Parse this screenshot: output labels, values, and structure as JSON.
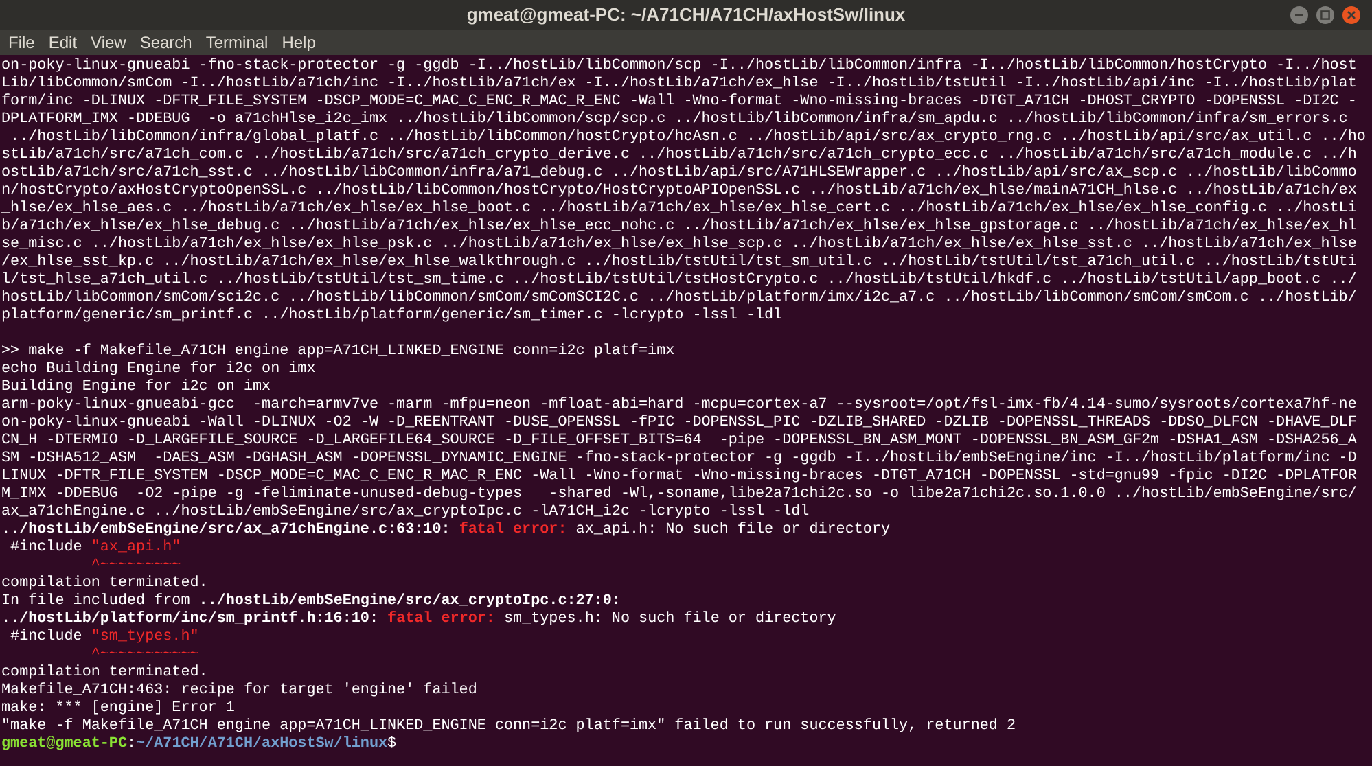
{
  "window": {
    "title": "gmeat@gmeat-PC: ~/A71CH/A71CH/axHostSw/linux"
  },
  "menu": [
    "File",
    "Edit",
    "View",
    "Search",
    "Terminal",
    "Help"
  ],
  "lines": [
    {
      "kind": "text",
      "segments": [
        {
          "kind": "plain",
          "text": "on-poky-linux-gnueabi -fno-stack-protector -g -ggdb -I../hostLib/libCommon/scp -I../hostLib/libCommon/infra -I../hostLib/libCommon/hostCrypto -I../host"
        }
      ]
    },
    {
      "kind": "text",
      "segments": [
        {
          "kind": "plain",
          "text": "Lib/libCommon/smCom -I../hostLib/a71ch/inc -I../hostLib/a71ch/ex -I../hostLib/a71ch/ex_hlse -I../hostLib/tstUtil -I../hostLib/api/inc -I../hostLib/plat"
        }
      ]
    },
    {
      "kind": "text",
      "segments": [
        {
          "kind": "plain",
          "text": "form/inc -DLINUX -DFTR_FILE_SYSTEM -DSCP_MODE=C_MAC_C_ENC_R_MAC_R_ENC -Wall -Wno-format -Wno-missing-braces -DTGT_A71CH -DHOST_CRYPTO -DOPENSSL -DI2C -"
        }
      ]
    },
    {
      "kind": "text",
      "segments": [
        {
          "kind": "plain",
          "text": "DPLATFORM_IMX -DDEBUG  -o a71chHlse_i2c_imx ../hostLib/libCommon/scp/scp.c ../hostLib/libCommon/infra/sm_apdu.c ../hostLib/libCommon/infra/sm_errors.c"
        }
      ]
    },
    {
      "kind": "text",
      "segments": [
        {
          "kind": "plain",
          "text": " ../hostLib/libCommon/infra/global_platf.c ../hostLib/libCommon/hostCrypto/hcAsn.c ../hostLib/api/src/ax_crypto_rng.c ../hostLib/api/src/ax_util.c ../ho"
        }
      ]
    },
    {
      "kind": "text",
      "segments": [
        {
          "kind": "plain",
          "text": "stLib/a71ch/src/a71ch_com.c ../hostLib/a71ch/src/a71ch_crypto_derive.c ../hostLib/a71ch/src/a71ch_crypto_ecc.c ../hostLib/a71ch/src/a71ch_module.c ../h"
        }
      ]
    },
    {
      "kind": "text",
      "segments": [
        {
          "kind": "plain",
          "text": "ostLib/a71ch/src/a71ch_sst.c ../hostLib/libCommon/infra/a71_debug.c ../hostLib/api/src/A71HLSEWrapper.c ../hostLib/api/src/ax_scp.c ../hostLib/libCommo"
        }
      ]
    },
    {
      "kind": "text",
      "segments": [
        {
          "kind": "plain",
          "text": "n/hostCrypto/axHostCryptoOpenSSL.c ../hostLib/libCommon/hostCrypto/HostCryptoAPIOpenSSL.c ../hostLib/a71ch/ex_hlse/mainA71CH_hlse.c ../hostLib/a71ch/ex"
        }
      ]
    },
    {
      "kind": "text",
      "segments": [
        {
          "kind": "plain",
          "text": "_hlse/ex_hlse_aes.c ../hostLib/a71ch/ex_hlse/ex_hlse_boot.c ../hostLib/a71ch/ex_hlse/ex_hlse_cert.c ../hostLib/a71ch/ex_hlse/ex_hlse_config.c ../hostLi"
        }
      ]
    },
    {
      "kind": "text",
      "segments": [
        {
          "kind": "plain",
          "text": "b/a71ch/ex_hlse/ex_hlse_debug.c ../hostLib/a71ch/ex_hlse/ex_hlse_ecc_nohc.c ../hostLib/a71ch/ex_hlse/ex_hlse_gpstorage.c ../hostLib/a71ch/ex_hlse/ex_hl"
        }
      ]
    },
    {
      "kind": "text",
      "segments": [
        {
          "kind": "plain",
          "text": "se_misc.c ../hostLib/a71ch/ex_hlse/ex_hlse_psk.c ../hostLib/a71ch/ex_hlse/ex_hlse_scp.c ../hostLib/a71ch/ex_hlse/ex_hlse_sst.c ../hostLib/a71ch/ex_hlse"
        }
      ]
    },
    {
      "kind": "text",
      "segments": [
        {
          "kind": "plain",
          "text": "/ex_hlse_sst_kp.c ../hostLib/a71ch/ex_hlse/ex_hlse_walkthrough.c ../hostLib/tstUtil/tst_sm_util.c ../hostLib/tstUtil/tst_a71ch_util.c ../hostLib/tstUti"
        }
      ]
    },
    {
      "kind": "text",
      "segments": [
        {
          "kind": "plain",
          "text": "l/tst_hlse_a71ch_util.c ../hostLib/tstUtil/tst_sm_time.c ../hostLib/tstUtil/tstHostCrypto.c ../hostLib/tstUtil/hkdf.c ../hostLib/tstUtil/app_boot.c ../"
        }
      ]
    },
    {
      "kind": "text",
      "segments": [
        {
          "kind": "plain",
          "text": "hostLib/libCommon/smCom/sci2c.c ../hostLib/libCommon/smCom/smComSCI2C.c ../hostLib/platform/imx/i2c_a7.c ../hostLib/libCommon/smCom/smCom.c ../hostLib/"
        }
      ]
    },
    {
      "kind": "text",
      "segments": [
        {
          "kind": "plain",
          "text": "platform/generic/sm_printf.c ../hostLib/platform/generic/sm_timer.c -lcrypto -lssl -ldl"
        }
      ]
    },
    {
      "kind": "blank"
    },
    {
      "kind": "text",
      "segments": [
        {
          "kind": "plain",
          "text": ">> make -f Makefile_A71CH engine app=A71CH_LINKED_ENGINE conn=i2c platf=imx"
        }
      ]
    },
    {
      "kind": "text",
      "segments": [
        {
          "kind": "plain",
          "text": "echo Building Engine for i2c on imx"
        }
      ]
    },
    {
      "kind": "text",
      "segments": [
        {
          "kind": "plain",
          "text": "Building Engine for i2c on imx"
        }
      ]
    },
    {
      "kind": "text",
      "segments": [
        {
          "kind": "plain",
          "text": "arm-poky-linux-gnueabi-gcc  -march=armv7ve -marm -mfpu=neon -mfloat-abi=hard -mcpu=cortex-a7 --sysroot=/opt/fsl-imx-fb/4.14-sumo/sysroots/cortexa7hf-ne"
        }
      ]
    },
    {
      "kind": "text",
      "segments": [
        {
          "kind": "plain",
          "text": "on-poky-linux-gnueabi -Wall -DLINUX -O2 -W -D_REENTRANT -DUSE_OPENSSL -fPIC -DOPENSSL_PIC -DZLIB_SHARED -DZLIB -DOPENSSL_THREADS -DDSO_DLFCN -DHAVE_DLF"
        }
      ]
    },
    {
      "kind": "text",
      "segments": [
        {
          "kind": "plain",
          "text": "CN_H -DTERMIO -D_LARGEFILE_SOURCE -D_LARGEFILE64_SOURCE -D_FILE_OFFSET_BITS=64  -pipe -DOPENSSL_BN_ASM_MONT -DOPENSSL_BN_ASM_GF2m -DSHA1_ASM -DSHA256_A"
        }
      ]
    },
    {
      "kind": "text",
      "segments": [
        {
          "kind": "plain",
          "text": "SM -DSHA512_ASM  -DAES_ASM -DGHASH_ASM -DOPENSSL_DYNAMIC_ENGINE -fno-stack-protector -g -ggdb -I../hostLib/embSeEngine/inc -I../hostLib/platform/inc -D"
        }
      ]
    },
    {
      "kind": "text",
      "segments": [
        {
          "kind": "plain",
          "text": "LINUX -DFTR_FILE_SYSTEM -DSCP_MODE=C_MAC_C_ENC_R_MAC_R_ENC -Wall -Wno-format -Wno-missing-braces -DTGT_A71CH -DOPENSSL -std=gnu99 -fpic -DI2C -DPLATFOR"
        }
      ]
    },
    {
      "kind": "text",
      "segments": [
        {
          "kind": "plain",
          "text": "M_IMX -DDEBUG  -O2 -pipe -g -feliminate-unused-debug-types   -shared -Wl,-soname,libe2a71chi2c.so -o libe2a71chi2c.so.1.0.0 ../hostLib/embSeEngine/src/"
        }
      ]
    },
    {
      "kind": "text",
      "segments": [
        {
          "kind": "plain",
          "text": "ax_a71chEngine.c ../hostLib/embSeEngine/src/ax_cryptoIpc.c -lA71CH_i2c -lcrypto -lssl -ldl"
        }
      ]
    },
    {
      "kind": "text",
      "segments": [
        {
          "kind": "bold",
          "text": "../hostLib/embSeEngine/src/ax_a71chEngine.c:63:10: "
        },
        {
          "kind": "error",
          "text": "fatal error: "
        },
        {
          "kind": "plain",
          "text": "ax_api.h: No such file or directory"
        }
      ]
    },
    {
      "kind": "text",
      "segments": [
        {
          "kind": "plain",
          "text": " #include "
        },
        {
          "kind": "red",
          "text": "\"ax_api.h\""
        }
      ]
    },
    {
      "kind": "text",
      "segments": [
        {
          "kind": "red",
          "text": "          ^~~~~~~~~~"
        }
      ]
    },
    {
      "kind": "text",
      "segments": [
        {
          "kind": "plain",
          "text": "compilation terminated."
        }
      ]
    },
    {
      "kind": "text",
      "segments": [
        {
          "kind": "plain",
          "text": "In file included from "
        },
        {
          "kind": "bold",
          "text": "../hostLib/embSeEngine/src/ax_cryptoIpc.c:27:0:"
        }
      ]
    },
    {
      "kind": "text",
      "segments": [
        {
          "kind": "bold",
          "text": "../hostLib/platform/inc/sm_printf.h:16:10: "
        },
        {
          "kind": "error",
          "text": "fatal error: "
        },
        {
          "kind": "plain",
          "text": "sm_types.h: No such file or directory"
        }
      ]
    },
    {
      "kind": "text",
      "segments": [
        {
          "kind": "plain",
          "text": " #include "
        },
        {
          "kind": "red",
          "text": "\"sm_types.h\""
        }
      ]
    },
    {
      "kind": "text",
      "segments": [
        {
          "kind": "red",
          "text": "          ^~~~~~~~~~~~"
        }
      ]
    },
    {
      "kind": "text",
      "segments": [
        {
          "kind": "plain",
          "text": "compilation terminated."
        }
      ]
    },
    {
      "kind": "text",
      "segments": [
        {
          "kind": "plain",
          "text": "Makefile_A71CH:463: recipe for target 'engine' failed"
        }
      ]
    },
    {
      "kind": "text",
      "segments": [
        {
          "kind": "plain",
          "text": "make: *** [engine] Error 1"
        }
      ]
    },
    {
      "kind": "text",
      "segments": [
        {
          "kind": "plain",
          "text": "\"make -f Makefile_A71CH engine app=A71CH_LINKED_ENGINE conn=i2c platf=imx\" failed to run successfully, returned 2"
        }
      ]
    },
    {
      "kind": "text",
      "segments": [
        {
          "kind": "user",
          "text": "gmeat@gmeat-PC"
        },
        {
          "kind": "plain",
          "text": ":"
        },
        {
          "kind": "path",
          "text": "~/A71CH/A71CH/axHostSw/linux"
        },
        {
          "kind": "plain",
          "text": "$"
        }
      ]
    }
  ]
}
